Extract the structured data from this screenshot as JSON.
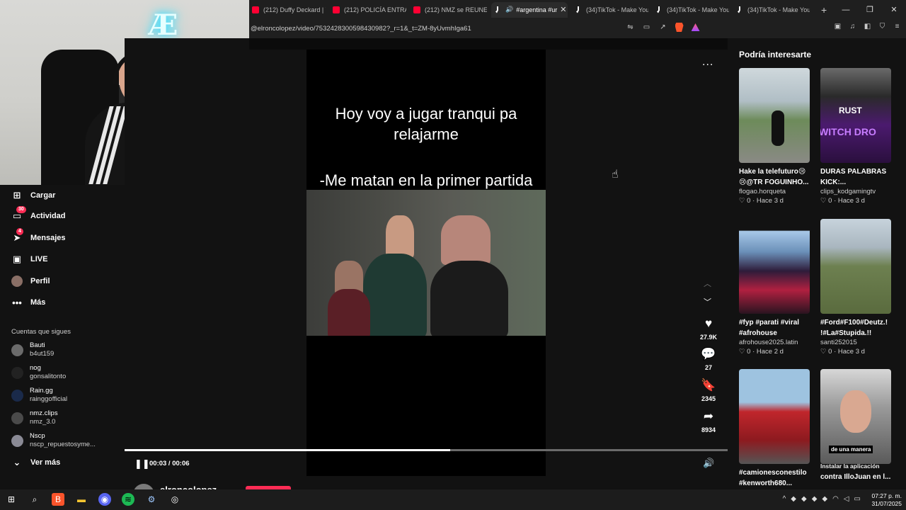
{
  "browser": {
    "tabs": [
      {
        "title": "(212) Duffy Deckard | Y",
        "favicon": "youtube-icon"
      },
      {
        "title": "(212) POLICÍA ENTRA A",
        "favicon": "youtube-icon"
      },
      {
        "title": "(212) NMZ se REUNE c",
        "favicon": "youtube-icon"
      },
      {
        "title": "#argentina #ur",
        "favicon": "tiktok-icon",
        "active": true
      },
      {
        "title": "(34)TikTok - Make You",
        "favicon": "tiktok-icon"
      },
      {
        "title": "(34)TikTok - Make You",
        "favicon": "tiktok-icon"
      },
      {
        "title": "(34)TikTok - Make You",
        "favicon": "tiktok-icon"
      }
    ],
    "url": "@elroncolopez/video/7532428300598430982?_r=1&_t=ZM-8yUvmhIga61"
  },
  "left_nav": {
    "items": [
      {
        "label": "Cargar",
        "icon": "upload-icon"
      },
      {
        "label": "Actividad",
        "icon": "inbox-icon",
        "badge": "30"
      },
      {
        "label": "Mensajes",
        "icon": "send-icon",
        "badge": "4"
      },
      {
        "label": "LIVE",
        "icon": "live-icon"
      },
      {
        "label": "Perfil",
        "icon": "avatar"
      },
      {
        "label": "Más",
        "icon": "more-icon"
      }
    ],
    "following_title": "Cuentas que sigues",
    "following": [
      {
        "name": "Bauti",
        "handle": "b4ut159"
      },
      {
        "name": "nog",
        "handle": "gonsalitonto"
      },
      {
        "name": "Rain.gg",
        "handle": "rainggofficial"
      },
      {
        "name": "nmz.clips",
        "handle": "nmz_3.0"
      },
      {
        "name": "Nscp",
        "handle": "nscp_repuestosyme..."
      }
    ],
    "see_more": "Ver más"
  },
  "video": {
    "caption_line1": "Hoy voy a jugar tranqui pa relajarme",
    "caption_line2": "-Me matan en la primer partida",
    "more_label": "...",
    "actions": {
      "likes": "27.9K",
      "comments": "27",
      "saves": "2345",
      "shares": "8934"
    },
    "time": "00:03 / 00:06",
    "progress": 0.54,
    "author": "elroncolopez"
  },
  "recommendations": {
    "title": "Podría interesarte",
    "cards": [
      {
        "desc": "Hake la telefuturo😢 😢@TR FOGUINHO...",
        "user": "flogao.horqueta",
        "likes": "0",
        "age": "Hace 3 d",
        "thumb_text": ""
      },
      {
        "desc": "DURAS PALABRAS KICK:...",
        "user": "clips_kodgamingtv",
        "likes": "0",
        "age": "Hace 3 d",
        "thumb_text": "RUST\nWITCH DRO"
      },
      {
        "desc": "#fyp #parati #viral #afrohouse",
        "user": "afrohouse2025.latin",
        "likes": "0",
        "age": "Hace 2 d",
        "thumb_text": ""
      },
      {
        "desc": "#Ford#F100#Deutz.! !#La#Stupida.!!",
        "user": "santi252015",
        "likes": "0",
        "age": "Hace 3 d",
        "thumb_text": ""
      },
      {
        "desc": "#camionesconestilo #kenworth680...",
        "user": "",
        "likes": "",
        "age": "",
        "thumb_text": ""
      },
      {
        "desc": "contra IlloJuan en l...",
        "user": "",
        "likes": "",
        "age": "",
        "thumb_text": "de una manera",
        "overlay": "Instalar la aplicación"
      }
    ]
  },
  "taskbar": {
    "time": "07:27 p. m.",
    "date": "31/07/2025"
  }
}
